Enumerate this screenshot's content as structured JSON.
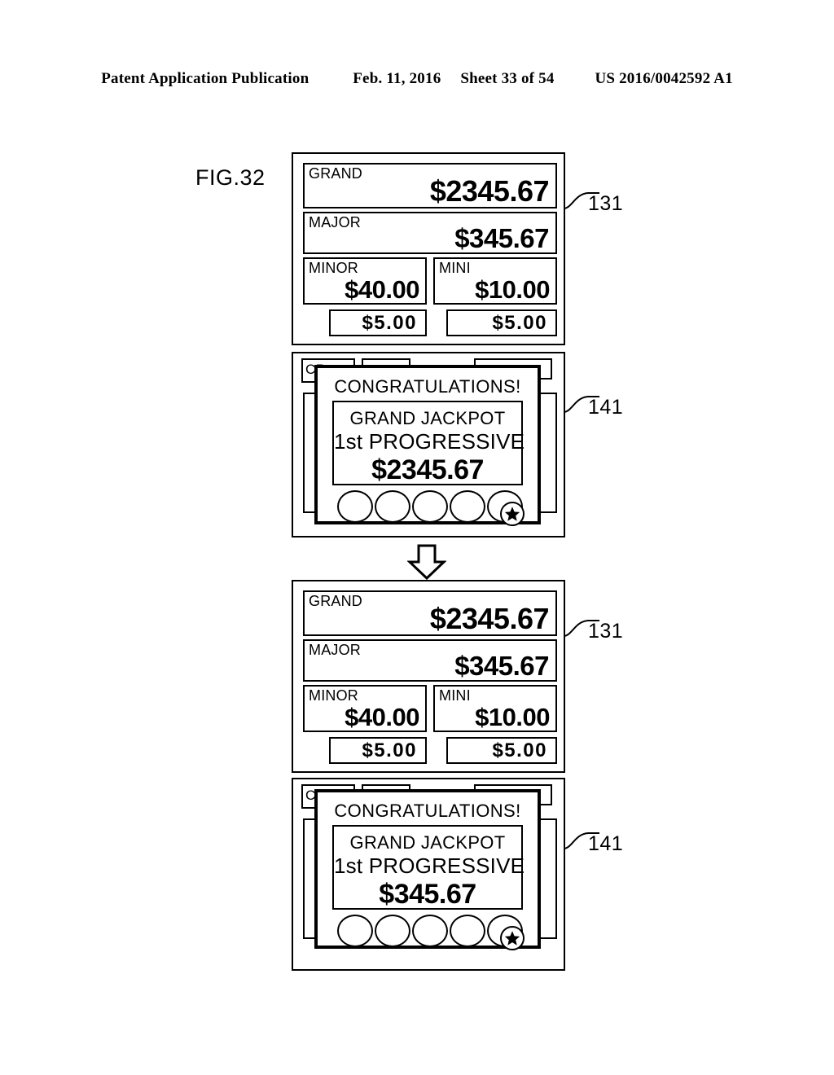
{
  "header": {
    "publication": "Patent Application Publication",
    "date": "Feb. 11, 2016",
    "sheet": "Sheet 33 of 54",
    "patent_number": "US 2016/0042592 A1"
  },
  "figure": {
    "label": "FIG.32"
  },
  "reference_numerals": {
    "meter_panel_top": "131",
    "slot_panel_top": "141",
    "meter_panel_bottom": "131",
    "slot_panel_bottom": "141"
  },
  "meter_panel": {
    "rows": [
      {
        "label": "GRAND",
        "value": "$2345.67"
      },
      {
        "label": "MAJOR",
        "value": "$345.67"
      },
      {
        "label": "MINOR",
        "value": "$40.00"
      },
      {
        "label": "MINI",
        "value": "$10.00"
      }
    ],
    "bet_left": "$5.00",
    "bet_right": "$5.00"
  },
  "slot_panel_top": {
    "credit_label": "CR",
    "dialog": {
      "title": "CONGRATULATIONS!",
      "line1": "GRAND JACKPOT",
      "line2": "1st PROGRESSIVE",
      "amount": "$2345.67"
    },
    "reel_symbols": [
      "blank-circle",
      "blank-circle",
      "blank-circle",
      "blank-circle",
      "star-circle"
    ]
  },
  "slot_panel_bottom": {
    "credit_label": "CR",
    "dialog": {
      "title": "CONGRATULATIONS!",
      "line1": "GRAND JACKPOT",
      "line2": "1st PROGRESSIVE",
      "amount": "$345.67"
    },
    "reel_symbols": [
      "blank-circle",
      "blank-circle",
      "blank-circle",
      "blank-circle",
      "star-circle"
    ]
  },
  "flow": {
    "arrow": "down-arrow"
  },
  "colors": {
    "ink": "#000000",
    "paper": "#ffffff"
  }
}
